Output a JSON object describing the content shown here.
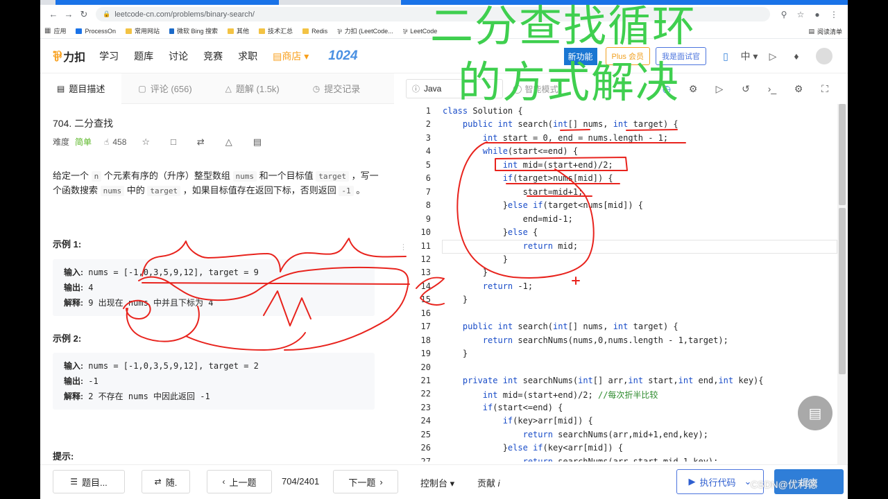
{
  "browser": {
    "url": "leetcode-cn.com/problems/binary-search/",
    "bookmarks": [
      "应用",
      "ProcessOn",
      "常用网站",
      "微软 Bing 搜索",
      "其他",
      "技术汇总",
      "Redis",
      "力扣 (LeetCode...",
      "LeetCode"
    ],
    "reading_list": "阅读清单"
  },
  "header": {
    "logo": "力扣",
    "nav": [
      "学习",
      "题库",
      "讨论",
      "竞赛",
      "求职",
      "商店"
    ],
    "badge": "1024",
    "new_feature": "新功能",
    "plus": "Plus 会员",
    "interviewer": "我是面试官",
    "lang": "中"
  },
  "left_tabs": [
    "题目描述",
    "评论 (656)",
    "题解 (1.5k)",
    "提交记录"
  ],
  "problem": {
    "title": "704. 二分查找",
    "difficulty_label": "难度",
    "difficulty": "简单",
    "likes": "458",
    "desc_1": "给定一个",
    "desc_n": "n",
    "desc_2": "个元素有序的（升序）整型数组",
    "desc_nums": "nums",
    "desc_3": "和一个目标值",
    "desc_target": "target",
    "desc_4": "，写一个函数搜索",
    "desc_nums2": "nums",
    "desc_5": "中的",
    "desc_target2": "target",
    "desc_6": "，如果目标值存在返回下标，否则返回",
    "desc_m1": "-1",
    "desc_7": "。",
    "example1_title": "示例 1:",
    "example1": {
      "in_label": "输入:",
      "in": " nums = [-1,0,3,5,9,12], target = 9",
      "out_label": "输出:",
      "out": " 4",
      "exp_label": "解释:",
      "exp": " 9 出现在 nums 中并且下标为 4"
    },
    "example2_title": "示例 2:",
    "example2": {
      "in_label": "输入:",
      "in": " nums = [-1,0,3,5,9,12], target = 2",
      "out_label": "输出:",
      "out": " -1",
      "exp_label": "解释:",
      "exp": " 2 不存在 nums 中因此返回 -1"
    },
    "hint_title": "提示:"
  },
  "editor": {
    "language": "Java",
    "mode": "智能模式",
    "line_numbers": [
      "1",
      "2",
      "3",
      "4",
      "5",
      "6",
      "7",
      "8",
      "9",
      "10",
      "11",
      "12",
      "13",
      "14",
      "15",
      "16",
      "17",
      "18",
      "19",
      "20",
      "21",
      "22",
      "23",
      "24",
      "25",
      "26",
      "27"
    ],
    "lines": [
      "class Solution {",
      "    public int search(int[] nums, int target) {",
      "        int start = 0, end = nums.length - 1;",
      "        while(start<=end) {",
      "            int mid=(start+end)/2;",
      "            if(target>nums[mid]) {",
      "                start=mid+1;",
      "            }else if(target<nums[mid]) {",
      "                end=mid-1;",
      "            }else {",
      "                return mid;",
      "            }",
      "        }",
      "        return -1;",
      "    }",
      "",
      "    public int search(int[] nums, int target) {",
      "        return searchNums(nums,0,nums.length - 1,target);",
      "    }",
      "",
      "    private int searchNums(int[] arr,int start,int end,int key){",
      "        int mid=(start+end)/2; //每次折半比较",
      "        if(start<=end) {",
      "            if(key>arr[mid]) {",
      "                return searchNums(arr,mid+1,end,key);",
      "            }else if(key<arr[mid]) {",
      "                return searchNums(arr,start,mid-1,key);"
    ]
  },
  "bottom": {
    "list": "题目...",
    "random": "随.",
    "prev": "上一题",
    "page": "704/2401",
    "next": "下一题",
    "console": "控制台",
    "contribute": "贡献",
    "run": "执行代码",
    "submit": "提交"
  },
  "overlay": {
    "line1": "二分查找循环",
    "line2": "的方式解决"
  },
  "watermark": "CSDN@优利德",
  "colors": {
    "accent": "#2f7ed8",
    "easy": "#5ab726",
    "overlay_text": "#3fcf4f",
    "ink": "#e8231d"
  }
}
